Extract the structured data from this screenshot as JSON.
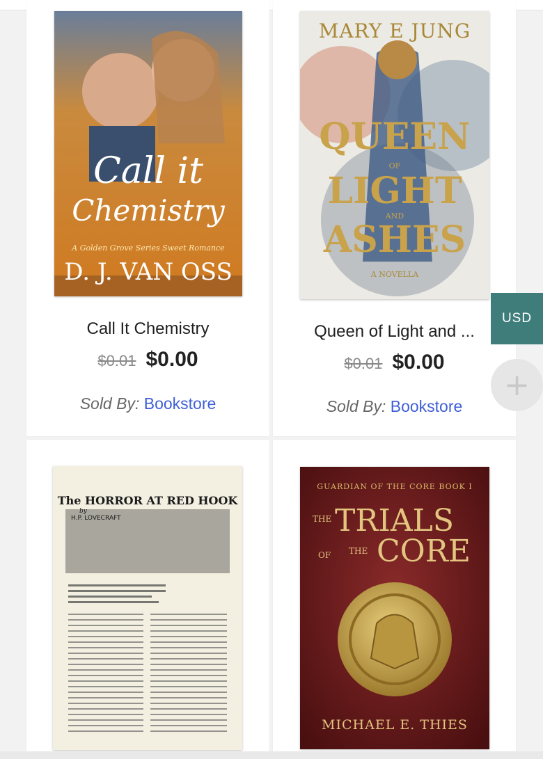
{
  "currency": "USD",
  "fab_symbol": "+",
  "products": [
    {
      "title": "Call It Chemistry",
      "old_price": "$0.01",
      "price": "$0.00",
      "sold_by_label": "Sold By:",
      "seller": "Bookstore",
      "cover": {
        "line1": "Call it",
        "line2": "Chemistry",
        "series": "A Golden Grove Series Sweet Romance",
        "author": "D. J. VAN OSS"
      }
    },
    {
      "title": "Queen of Light and ...",
      "old_price": "$0.01",
      "price": "$0.00",
      "sold_by_label": "Sold By:",
      "seller": "Bookstore",
      "cover": {
        "author": "MARY E JUNG",
        "w1": "QUEEN",
        "w2": "OF",
        "w3": "LIGHT",
        "w4": "AND",
        "w5": "ASHES",
        "tag": "A NOVELLA"
      }
    },
    {
      "cover": {
        "title": "The HORROR AT RED HOOK",
        "by": "by",
        "author": "H.P. LOVECRAFT"
      }
    },
    {
      "cover": {
        "series": "GUARDIAN OF THE CORE BOOK I",
        "w1": "THE",
        "w2": "TRIALS",
        "w3": "OF",
        "w4": "THE",
        "w5": "CORE",
        "author": "MICHAEL E. THIES"
      }
    }
  ]
}
